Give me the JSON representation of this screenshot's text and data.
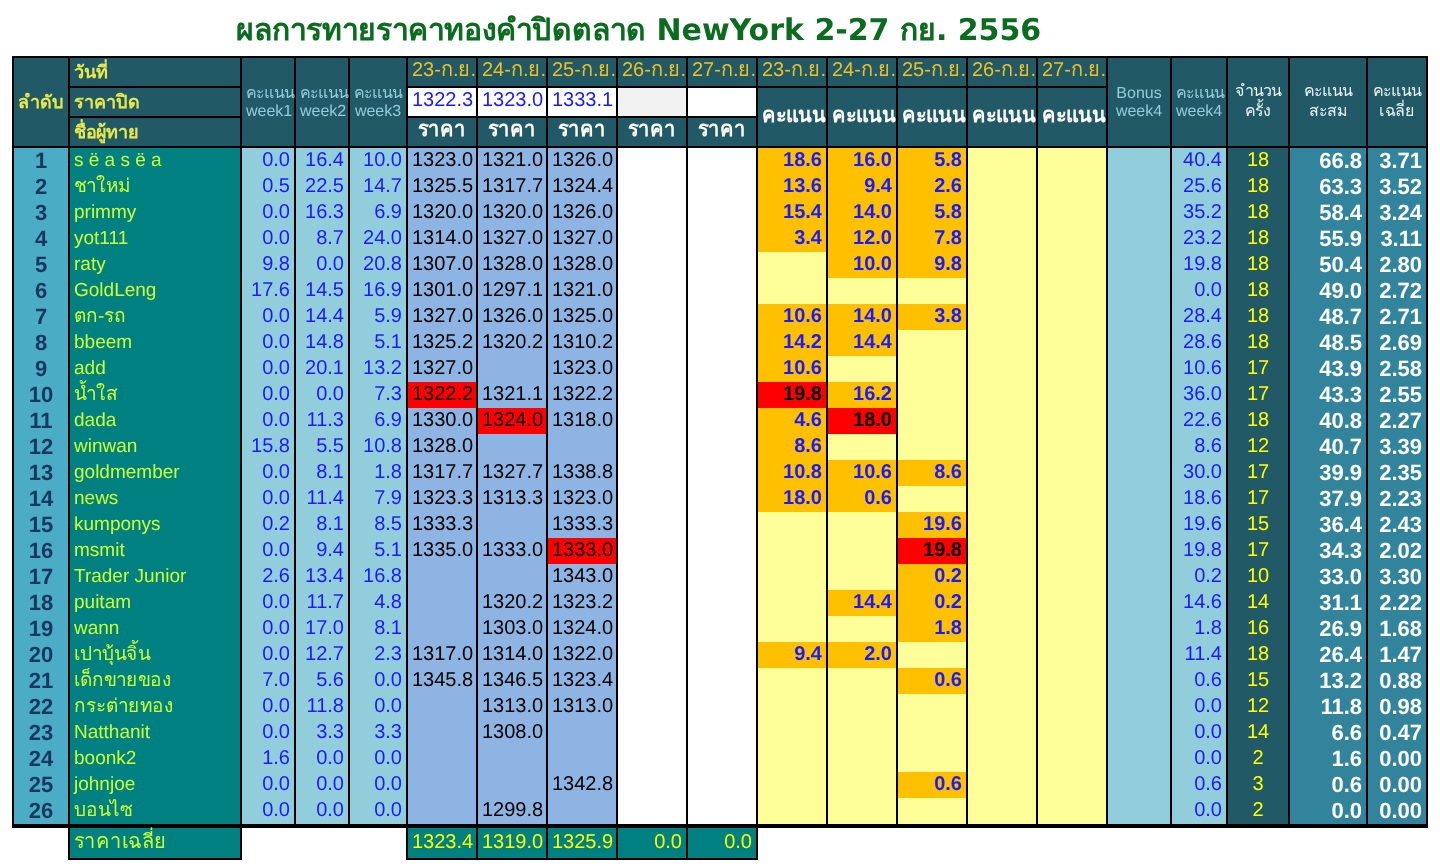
{
  "title": "ผลการทายราคาทองคำปิดตลาด NewYork 2-27 กย. 2556",
  "header": {
    "rank": "ลำดับ",
    "date_label": "วันที่",
    "close_label": "ราคาปิด",
    "name_label": "ชื่อผู้ทาย",
    "weeks": [
      "คะแนน week1",
      "คะแนน week2",
      "คะแนน week3"
    ],
    "price_days": [
      {
        "date": "23-ก.ย.",
        "close": "1322.3",
        "label": "ราคา"
      },
      {
        "date": "24-ก.ย.",
        "close": "1323.0",
        "label": "ราคา"
      },
      {
        "date": "25-ก.ย.",
        "close": "1333.1",
        "label": "ราคา"
      },
      {
        "date": "26-ก.ย.",
        "label": "ราคา"
      },
      {
        "date": "27-ก.ย.",
        "label": "ราคา"
      }
    ],
    "score_days": [
      {
        "date": "23-ก.ย.",
        "label": "คะแนน"
      },
      {
        "date": "24-ก.ย.",
        "label": "คะแนน"
      },
      {
        "date": "25-ก.ย.",
        "label": "คะแนน"
      },
      {
        "date": "26-ก.ย.",
        "label": "คะแนน"
      },
      {
        "date": "27-ก.ย.",
        "label": "คะแนน"
      }
    ],
    "bonus": "Bonus week4",
    "week4": "คะแนน week4",
    "count": "จำนวนครั้ง",
    "total": "คะแนนสะสม",
    "average": "คะแนนเฉลี่ย"
  },
  "rows": [
    {
      "rank": "1",
      "name": "s ë a s ë a",
      "weeks": [
        "0.0",
        "16.4",
        "10.0"
      ],
      "days": [
        {
          "price": "1323.0",
          "score": "18.6",
          "winner": false
        },
        {
          "price": "1321.0",
          "score": "16.0",
          "winner": false
        },
        {
          "price": "1326.0",
          "score": "5.8",
          "winner": false
        }
      ],
      "week4": "40.4",
      "count": "18",
      "total": "66.8",
      "average": "3.71"
    },
    {
      "rank": "2",
      "name": "ชาใหม่",
      "weeks": [
        "0.5",
        "22.5",
        "14.7"
      ],
      "days": [
        {
          "price": "1325.5",
          "score": "13.6",
          "winner": false
        },
        {
          "price": "1317.7",
          "score": "9.4",
          "winner": false
        },
        {
          "price": "1324.4",
          "score": "2.6",
          "winner": false
        }
      ],
      "week4": "25.6",
      "count": "18",
      "total": "63.3",
      "average": "3.52"
    },
    {
      "rank": "3",
      "name": "primmy",
      "weeks": [
        "0.0",
        "16.3",
        "6.9"
      ],
      "days": [
        {
          "price": "1320.0",
          "score": "15.4",
          "winner": false
        },
        {
          "price": "1320.0",
          "score": "14.0",
          "winner": false
        },
        {
          "price": "1326.0",
          "score": "5.8",
          "winner": false
        }
      ],
      "week4": "35.2",
      "count": "18",
      "total": "58.4",
      "average": "3.24"
    },
    {
      "rank": "4",
      "name": "yot111",
      "weeks": [
        "0.0",
        "8.7",
        "24.0"
      ],
      "days": [
        {
          "price": "1314.0",
          "score": "3.4",
          "winner": false
        },
        {
          "price": "1327.0",
          "score": "12.0",
          "winner": false
        },
        {
          "price": "1327.0",
          "score": "7.8",
          "winner": false
        }
      ],
      "week4": "23.2",
      "count": "18",
      "total": "55.9",
      "average": "3.11"
    },
    {
      "rank": "5",
      "name": "raty",
      "weeks": [
        "9.8",
        "0.0",
        "20.8"
      ],
      "days": [
        {
          "price": "1307.0",
          "winner": false
        },
        {
          "price": "1328.0",
          "score": "10.0",
          "winner": false
        },
        {
          "price": "1328.0",
          "score": "9.8",
          "winner": false
        }
      ],
      "week4": "19.8",
      "count": "18",
      "total": "50.4",
      "average": "2.80"
    },
    {
      "rank": "6",
      "name": "GoldLeng",
      "weeks": [
        "17.6",
        "14.5",
        "16.9"
      ],
      "days": [
        {
          "price": "1301.0",
          "winner": false
        },
        {
          "price": "1297.1",
          "winner": false
        },
        {
          "price": "1321.0",
          "winner": false
        }
      ],
      "week4": "0.0",
      "count": "18",
      "total": "49.0",
      "average": "2.72"
    },
    {
      "rank": "7",
      "name": "ตก-รถ",
      "weeks": [
        "0.0",
        "14.4",
        "5.9"
      ],
      "days": [
        {
          "price": "1327.0",
          "score": "10.6",
          "winner": false
        },
        {
          "price": "1326.0",
          "score": "14.0",
          "winner": false
        },
        {
          "price": "1325.0",
          "score": "3.8",
          "winner": false
        }
      ],
      "week4": "28.4",
      "count": "18",
      "total": "48.7",
      "average": "2.71"
    },
    {
      "rank": "8",
      "name": "bbeem",
      "weeks": [
        "0.0",
        "14.8",
        "5.1"
      ],
      "days": [
        {
          "price": "1325.2",
          "score": "14.2",
          "winner": false
        },
        {
          "price": "1320.2",
          "score": "14.4",
          "winner": false
        },
        {
          "price": "1310.2",
          "winner": false
        }
      ],
      "week4": "28.6",
      "count": "18",
      "total": "48.5",
      "average": "2.69"
    },
    {
      "rank": "9",
      "name": "add",
      "weeks": [
        "0.0",
        "20.1",
        "13.2"
      ],
      "days": [
        {
          "price": "1327.0",
          "score": "10.6",
          "winner": false
        },
        {
          "winner": false
        },
        {
          "price": "1323.0",
          "winner": false
        }
      ],
      "week4": "10.6",
      "count": "17",
      "total": "43.9",
      "average": "2.58"
    },
    {
      "rank": "10",
      "name": "น้ำใส",
      "weeks": [
        "0.0",
        "0.0",
        "7.3"
      ],
      "days": [
        {
          "price": "1322.2",
          "score": "19.8",
          "winner": true
        },
        {
          "price": "1321.1",
          "score": "16.2",
          "winner": false
        },
        {
          "price": "1322.2",
          "winner": false
        }
      ],
      "week4": "36.0",
      "count": "17",
      "total": "43.3",
      "average": "2.55"
    },
    {
      "rank": "11",
      "name": "dada",
      "weeks": [
        "0.0",
        "11.3",
        "6.9"
      ],
      "days": [
        {
          "price": "1330.0",
          "score": "4.6",
          "winner": false
        },
        {
          "price": "1324.0",
          "score": "18.0",
          "winner": true
        },
        {
          "price": "1318.0",
          "winner": false
        }
      ],
      "week4": "22.6",
      "count": "18",
      "total": "40.8",
      "average": "2.27"
    },
    {
      "rank": "12",
      "name": "winwan",
      "weeks": [
        "15.8",
        "5.5",
        "10.8"
      ],
      "days": [
        {
          "price": "1328.0",
          "score": "8.6",
          "winner": false
        },
        {
          "winner": false
        },
        {
          "winner": false
        }
      ],
      "week4": "8.6",
      "count": "12",
      "total": "40.7",
      "average": "3.39"
    },
    {
      "rank": "13",
      "name": "goldmember",
      "weeks": [
        "0.0",
        "8.1",
        "1.8"
      ],
      "days": [
        {
          "price": "1317.7",
          "score": "10.8",
          "winner": false
        },
        {
          "price": "1327.7",
          "score": "10.6",
          "winner": false
        },
        {
          "price": "1338.8",
          "score": "8.6",
          "winner": false
        }
      ],
      "week4": "30.0",
      "count": "17",
      "total": "39.9",
      "average": "2.35"
    },
    {
      "rank": "14",
      "name": "news",
      "weeks": [
        "0.0",
        "11.4",
        "7.9"
      ],
      "days": [
        {
          "price": "1323.3",
          "score": "18.0",
          "winner": false
        },
        {
          "price": "1313.3",
          "score": "0.6",
          "winner": false
        },
        {
          "price": "1323.0",
          "winner": false
        }
      ],
      "week4": "18.6",
      "count": "17",
      "total": "37.9",
      "average": "2.23"
    },
    {
      "rank": "15",
      "name": "kumponys",
      "weeks": [
        "0.2",
        "8.1",
        "8.5"
      ],
      "days": [
        {
          "price": "1333.3",
          "winner": false
        },
        {
          "winner": false
        },
        {
          "price": "1333.3",
          "score": "19.6",
          "winner": false
        }
      ],
      "week4": "19.6",
      "count": "15",
      "total": "36.4",
      "average": "2.43"
    },
    {
      "rank": "16",
      "name": "msmit",
      "weeks": [
        "0.0",
        "9.4",
        "5.1"
      ],
      "days": [
        {
          "price": "1335.0",
          "winner": false
        },
        {
          "price": "1333.0",
          "winner": false
        },
        {
          "price": "1333.0",
          "score": "19.8",
          "winner": true
        }
      ],
      "week4": "19.8",
      "count": "17",
      "total": "34.3",
      "average": "2.02"
    },
    {
      "rank": "17",
      "name": "Trader Junior",
      "weeks": [
        "2.6",
        "13.4",
        "16.8"
      ],
      "days": [
        {
          "winner": false
        },
        {
          "winner": false
        },
        {
          "price": "1343.0",
          "score": "0.2",
          "winner": false
        }
      ],
      "week4": "0.2",
      "count": "10",
      "total": "33.0",
      "average": "3.30"
    },
    {
      "rank": "18",
      "name": "puitam",
      "weeks": [
        "0.0",
        "11.7",
        "4.8"
      ],
      "days": [
        {
          "winner": false
        },
        {
          "price": "1320.2",
          "score": "14.4",
          "winner": false
        },
        {
          "price": "1323.2",
          "score": "0.2",
          "winner": false
        }
      ],
      "week4": "14.6",
      "count": "14",
      "total": "31.1",
      "average": "2.22"
    },
    {
      "rank": "19",
      "name": "wann",
      "weeks": [
        "0.0",
        "17.0",
        "8.1"
      ],
      "days": [
        {
          "winner": false
        },
        {
          "price": "1303.0",
          "winner": false
        },
        {
          "price": "1324.0",
          "score": "1.8",
          "winner": false
        }
      ],
      "week4": "1.8",
      "count": "16",
      "total": "26.9",
      "average": "1.68"
    },
    {
      "rank": "20",
      "name": "เปาบุ้นจิ้น",
      "weeks": [
        "0.0",
        "12.7",
        "2.3"
      ],
      "days": [
        {
          "price": "1317.0",
          "score": "9.4",
          "winner": false
        },
        {
          "price": "1314.0",
          "score": "2.0",
          "winner": false
        },
        {
          "price": "1322.0",
          "winner": false
        }
      ],
      "week4": "11.4",
      "count": "18",
      "total": "26.4",
      "average": "1.47"
    },
    {
      "rank": "21",
      "name": "เด็กขายของ",
      "weeks": [
        "7.0",
        "5.6",
        "0.0"
      ],
      "days": [
        {
          "price": "1345.8",
          "winner": false
        },
        {
          "price": "1346.5",
          "winner": false
        },
        {
          "price": "1323.4",
          "score": "0.6",
          "winner": false
        }
      ],
      "week4": "0.6",
      "count": "15",
      "total": "13.2",
      "average": "0.88"
    },
    {
      "rank": "22",
      "name": "กระต่ายทอง",
      "weeks": [
        "0.0",
        "11.8",
        "0.0"
      ],
      "days": [
        {
          "winner": false
        },
        {
          "price": "1313.0",
          "winner": false
        },
        {
          "price": "1313.0",
          "winner": false
        }
      ],
      "week4": "0.0",
      "count": "12",
      "total": "11.8",
      "average": "0.98"
    },
    {
      "rank": "23",
      "name": "Natthanit",
      "weeks": [
        "0.0",
        "3.3",
        "3.3"
      ],
      "days": [
        {
          "winner": false
        },
        {
          "price": "1308.0",
          "winner": false
        },
        {
          "winner": false
        }
      ],
      "week4": "0.0",
      "count": "14",
      "total": "6.6",
      "average": "0.47"
    },
    {
      "rank": "24",
      "name": "boonk2",
      "weeks": [
        "1.6",
        "0.0",
        "0.0"
      ],
      "days": [
        {
          "winner": false
        },
        {
          "winner": false
        },
        {
          "winner": false
        }
      ],
      "week4": "0.0",
      "count": "2",
      "total": "1.6",
      "average": "0.00"
    },
    {
      "rank": "25",
      "name": "johnjoe",
      "weeks": [
        "0.0",
        "0.0",
        "0.0"
      ],
      "days": [
        {
          "winner": false
        },
        {
          "winner": false
        },
        {
          "price": "1342.8",
          "score": "0.6",
          "winner": false
        }
      ],
      "week4": "0.6",
      "count": "3",
      "total": "0.6",
      "average": "0.00"
    },
    {
      "rank": "26",
      "name": "บอนไซ",
      "weeks": [
        "0.0",
        "0.0",
        "0.0"
      ],
      "days": [
        {
          "winner": false
        },
        {
          "price": "1299.8",
          "winner": false
        },
        {
          "winner": false
        }
      ],
      "week4": "0.0",
      "count": "2",
      "total": "0.0",
      "average": "0.00"
    }
  ],
  "footer": {
    "label": "ราคาเฉลี่ย",
    "averages": [
      "1323.4",
      "1319.0",
      "1325.9",
      "0.0",
      "0.0"
    ]
  }
}
